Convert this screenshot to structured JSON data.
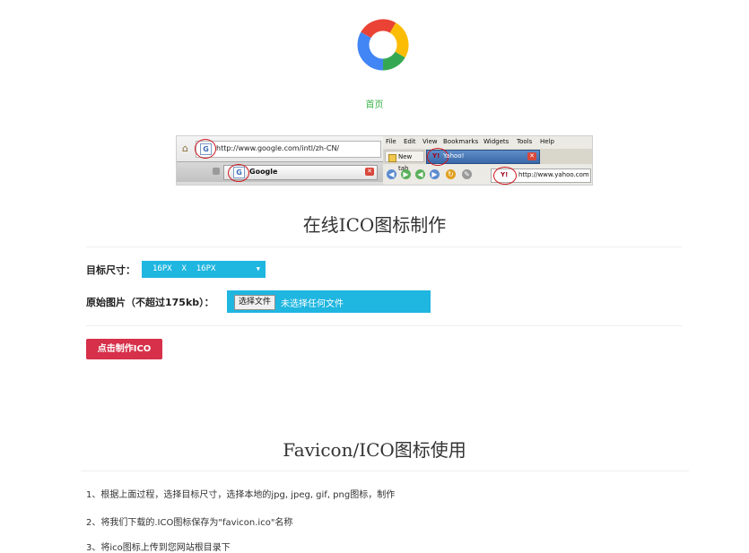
{
  "nav": {
    "home_label": "首页"
  },
  "demo": {
    "url": "http://www.google.com/intl/zh-CN/",
    "google_tab": "Google",
    "menu": [
      "File",
      "Edit",
      "View",
      "Bookmarks",
      "Widgets",
      "Tools",
      "Help"
    ],
    "new_tab": "New tab",
    "yahoo_tab": "Yahoo!",
    "yahoo_url": "http://www.yahoo.com"
  },
  "maker": {
    "title": "在线ICO图标制作",
    "size_label": "目标尺寸：",
    "size_value": "16PX  X  16PX",
    "source_label": "原始图片（不超过175kb）：",
    "file_button": "选择文件",
    "file_status": "未选择任何文件",
    "submit_label": "点击制作ICO"
  },
  "usage": {
    "title": "Favicon/ICO图标使用",
    "steps": [
      "1、根据上面过程，选择目标尺寸，选择本地的jpg, jpeg, gif, png图标，制作",
      "2、将我们下载的.ICO图标保存为\"favicon.ico\"名称",
      "3、将ico图标上传到您网站根目录下"
    ]
  },
  "colors": {
    "accent": "#1fb6e0",
    "button": "#d6304a",
    "link": "#3cb44b"
  }
}
